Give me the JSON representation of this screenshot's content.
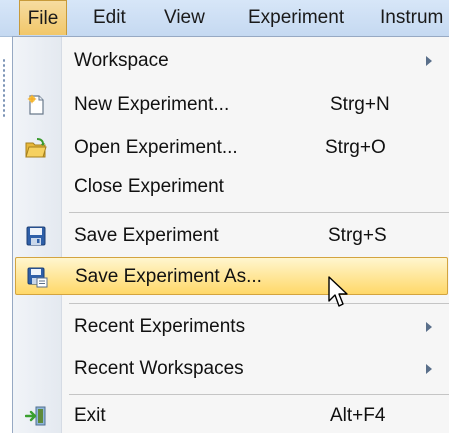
{
  "menubar": {
    "items": [
      {
        "label": "File"
      },
      {
        "label": "Edit"
      },
      {
        "label": "View"
      },
      {
        "label": "Experiment"
      },
      {
        "label": "Instrum"
      }
    ]
  },
  "menu": {
    "workspace": {
      "label": "Workspace",
      "submenu": true
    },
    "new_experiment": {
      "label": "New Experiment...",
      "shortcut": "Strg+N",
      "icon": "new-document-icon"
    },
    "open_experiment": {
      "label": "Open Experiment...",
      "shortcut": "Strg+O",
      "icon": "open-folder-icon"
    },
    "close_experiment": {
      "label": "Close Experiment"
    },
    "save_experiment": {
      "label": "Save Experiment",
      "shortcut": "Strg+S",
      "icon": "floppy-disk-icon"
    },
    "save_experiment_as": {
      "label": "Save Experiment As...",
      "icon": "save-as-icon",
      "highlighted": true
    },
    "recent_experiments": {
      "label": "Recent Experiments",
      "submenu": true
    },
    "recent_workspaces": {
      "label": "Recent Workspaces",
      "submenu": true
    },
    "exit": {
      "label": "Exit",
      "shortcut": "Alt+F4",
      "icon": "exit-door-icon"
    }
  },
  "colors": {
    "menubar_bg": "#c5d9f1",
    "highlight_bg": "#ffe79b",
    "highlight_border": "#d3a43f",
    "menu_bg": "#f6f6f6"
  }
}
